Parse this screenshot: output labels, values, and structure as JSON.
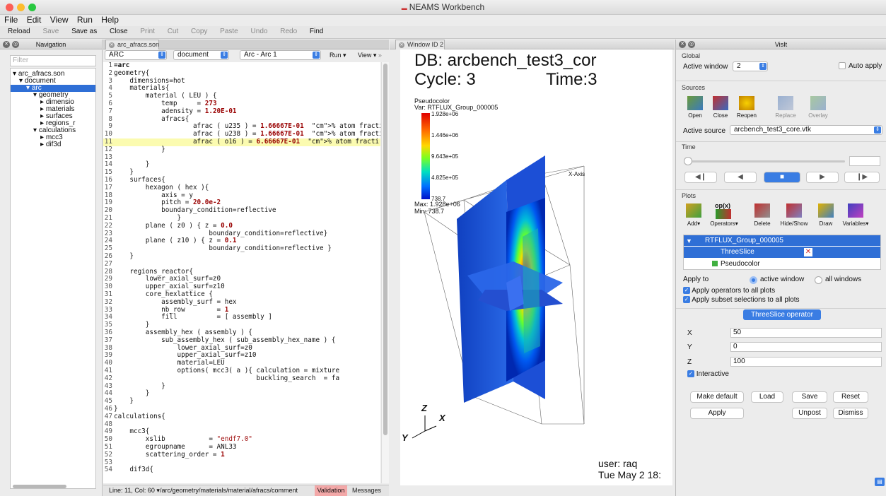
{
  "window": {
    "title": "NEAMS Workbench"
  },
  "menu": [
    "File",
    "Edit",
    "View",
    "Run",
    "Help"
  ],
  "toolbar": {
    "reload": "Reload",
    "save": "Save",
    "save_as": "Save as",
    "close": "Close",
    "print": "Print",
    "cut": "Cut",
    "copy": "Copy",
    "paste": "Paste",
    "undo": "Undo",
    "redo": "Redo",
    "find": "Find"
  },
  "navigation": {
    "title": "Navigation",
    "filter_placeholder": "Filter",
    "tree": [
      "arc_afracs.son",
      "document",
      "arc",
      "geometry",
      "dimensio",
      "materials",
      "surfaces",
      "regions_r",
      "calculations",
      "mcc3",
      "dif3d"
    ]
  },
  "editor": {
    "tab": "arc_afracs.son",
    "sel_app": "ARC",
    "sel_doc": "document",
    "sel_node": "Arc - Arc 1",
    "run": "Run",
    "view": "View",
    "lines": [
      [
        "1",
        "=arc"
      ],
      [
        "2",
        "geometry{"
      ],
      [
        "3",
        "    dimensions=hot"
      ],
      [
        "4",
        "    materials{"
      ],
      [
        "5",
        "        material ( LEU ) {"
      ],
      [
        "6",
        "            temp     = 273"
      ],
      [
        "7",
        "            adensity = 1.20E-01"
      ],
      [
        "8",
        "            afracs{"
      ],
      [
        "9",
        "                    afrac ( u235 ) = 1.66667E-01  % atom fracti"
      ],
      [
        "10",
        "                    afrac ( u238 ) = 1.66667E-01  % atom fracti"
      ],
      [
        "11",
        "                    afrac ( o16 ) = 6.66667E-01  % atom fracti"
      ],
      [
        "12",
        "            }"
      ],
      [
        "13",
        ""
      ],
      [
        "14",
        "        }"
      ],
      [
        "15",
        "    }"
      ],
      [
        "16",
        "    surfaces{"
      ],
      [
        "17",
        "        hexagon ( hex ){"
      ],
      [
        "18",
        "            axis = y"
      ],
      [
        "19",
        "            pitch = 20.0e-2"
      ],
      [
        "20",
        "            boundary_condition=reflective"
      ],
      [
        "21",
        "                }"
      ],
      [
        "22",
        "        plane ( z0 ) { z = 0.0"
      ],
      [
        "23",
        "                        boundary_condition=reflective}"
      ],
      [
        "24",
        "        plane ( z10 ) { z = 0.1"
      ],
      [
        "25",
        "                        boundary_condition=reflective }"
      ],
      [
        "26",
        "    }"
      ],
      [
        "27",
        ""
      ],
      [
        "28",
        "    regions_reactor{"
      ],
      [
        "29",
        "        lower_axial_surf=z0"
      ],
      [
        "30",
        "        upper_axial_surf=z10"
      ],
      [
        "31",
        "        core_hexlattice {"
      ],
      [
        "32",
        "            assembly_surf = hex"
      ],
      [
        "33",
        "            nb_row        = 1"
      ],
      [
        "34",
        "            fill          = [ assembly ]"
      ],
      [
        "35",
        "        }"
      ],
      [
        "36",
        "        assembly_hex ( assembly ) {"
      ],
      [
        "37",
        "            sub_assembly_hex ( sub_assembly_hex_name ) {"
      ],
      [
        "38",
        "                lower_axial_surf=z0"
      ],
      [
        "39",
        "                upper_axial_surf=z10"
      ],
      [
        "40",
        "                material=LEU"
      ],
      [
        "41",
        "                options( mcc3( a ){ calculation = mixture"
      ],
      [
        "42",
        "                                    buckling_search  = fa"
      ],
      [
        "43",
        "            }"
      ],
      [
        "44",
        "        }"
      ],
      [
        "45",
        "    }"
      ],
      [
        "46",
        "}"
      ],
      [
        "47",
        "calculations{"
      ],
      [
        "48",
        ""
      ],
      [
        "49",
        "    mcc3{"
      ],
      [
        "50",
        "        xslib           = \"endf7.0\""
      ],
      [
        "51",
        "        egroupname      = ANL33"
      ],
      [
        "52",
        "        scattering_order = 1"
      ],
      [
        "53",
        ""
      ],
      [
        "54",
        "    dif3d{"
      ]
    ],
    "status_line": "Line: 11, Col: 60",
    "status_path": "/arc/geometry/materials/material/afracs/comment",
    "validation": "Validation",
    "messages": "Messages"
  },
  "render": {
    "tab": "Window ID 2",
    "db": "DB: arcbench_test3_cor",
    "cycle": "Cycle: 3",
    "time": "Time:3",
    "legend_title": "Pseudocolor",
    "legend_var": "Var: RTFLUX_Group_000005",
    "legend_ticks": [
      "1.928e+06",
      "1.446e+06",
      "9.643e+05",
      "4.825e+05",
      "738.7"
    ],
    "legend_max": "Max: 1.928e+06",
    "legend_min": "Min: 738.7",
    "axis_label_x": "X-Axis",
    "axis_z": "Z",
    "axis_x": "X",
    "axis_y": "Y",
    "user": "user: raq",
    "date": "Tue May  2 18:"
  },
  "visit": {
    "title": "VisIt",
    "global": "Global",
    "active_window_label": "Active window",
    "active_window": "2",
    "auto_apply": "Auto apply",
    "sources": "Sources",
    "src_open": "Open",
    "src_close": "Close",
    "src_reopen": "Reopen",
    "src_replace": "Replace",
    "src_overlay": "Overlay",
    "active_source_label": "Active source",
    "active_source": "arcbench_test3_core.vtk",
    "time": "Time",
    "plots": "Plots",
    "pl_add": "Add",
    "pl_operators": "Operators",
    "pl_delete": "Delete",
    "pl_hideshow": "Hide/Show",
    "pl_draw": "Draw",
    "pl_variables": "Variables",
    "op_label": "op(x)",
    "plot_item": "RTFLUX_Group_000005",
    "op_item": "ThreeSlice",
    "plot_sub": "Pseudocolor",
    "apply_to": "Apply to",
    "active_window_opt": "active window",
    "all_windows_opt": "all windows",
    "apply_ops": "Apply operators to all plots",
    "apply_subset": "Apply subset selections to all plots",
    "op_title": "ThreeSlice operator",
    "x_label": "X",
    "x_val": "50",
    "y_label": "Y",
    "y_val": "0",
    "z_label": "Z",
    "z_val": "100",
    "interactive": "Interactive",
    "make_default": "Make default",
    "load": "Load",
    "save": "Save",
    "reset": "Reset",
    "apply": "Apply",
    "unpost": "Unpost",
    "dismiss": "Dismiss"
  },
  "colors": {
    "accent": "#2f6fd6",
    "validation": "#f3a8a8",
    "highlight": "#fbfbb0"
  }
}
